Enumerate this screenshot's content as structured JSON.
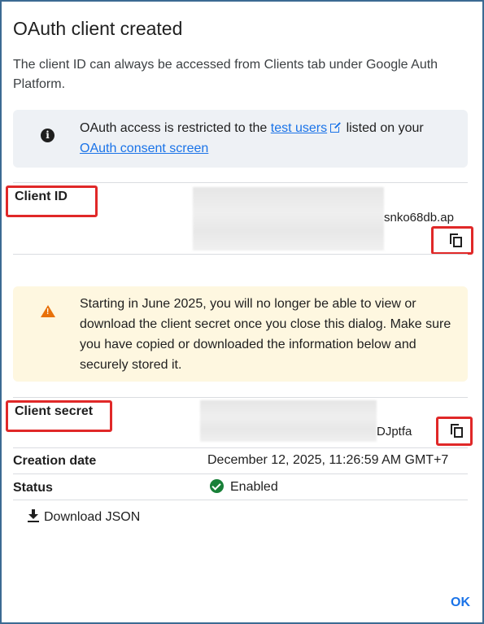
{
  "dialog": {
    "title": "OAuth client created",
    "intro": "The client ID can always be accessed from Clients tab under Google Auth Platform."
  },
  "info": {
    "icon": "info-icon",
    "text_before": "OAuth access is restricted to the ",
    "test_users_link": "test users",
    "text_middle": " listed on your ",
    "consent_link": "OAuth consent screen"
  },
  "client_id": {
    "label": "Client ID",
    "value_visible_tail": "snko68db.ap"
  },
  "warning": {
    "icon": "warning-icon",
    "text": "Starting in June 2025, you will no longer be able to view or download the client secret once you close this dialog. Make sure you have copied or downloaded the information below and securely stored it."
  },
  "client_secret": {
    "label": "Client secret",
    "value_visible_tail": "DJptfa"
  },
  "creation_date": {
    "label": "Creation date",
    "value": "December 12, 2025, 11:26:59 AM GMT+7"
  },
  "status": {
    "label": "Status",
    "value": "Enabled"
  },
  "actions": {
    "download_label": "Download JSON",
    "ok_label": "OK"
  },
  "colors": {
    "link": "#1a73e8",
    "annotation_red": "#e02828",
    "info_bg": "#eef1f5",
    "warning_bg": "#fef7e0",
    "warning_icon": "#e8710a",
    "enabled_green": "#188038"
  }
}
